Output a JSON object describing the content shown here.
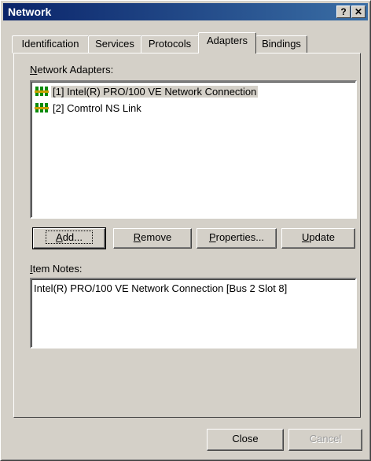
{
  "window": {
    "title": "Network",
    "help_label": "?",
    "close_label": "✕"
  },
  "tabs": [
    {
      "label": "Identification"
    },
    {
      "label": "Services"
    },
    {
      "label": "Protocols"
    },
    {
      "label": "Adapters"
    },
    {
      "label": "Bindings"
    }
  ],
  "active_tab": "Adapters",
  "adapters": {
    "label_prefix": "N",
    "label_rest": "etwork Adapters:",
    "items": [
      {
        "label": "[1] Intel(R) PRO/100 VE Network Connection",
        "icon": "network-card-icon",
        "selected": true
      },
      {
        "label": "[2] Comtrol NS Link",
        "icon": "network-card-icon",
        "selected": false
      }
    ]
  },
  "buttons": {
    "add": {
      "pre": "",
      "ul": "A",
      "post": "dd..."
    },
    "remove": {
      "pre": "",
      "ul": "R",
      "post": "emove"
    },
    "properties": {
      "pre": "",
      "ul": "P",
      "post": "roperties..."
    },
    "update": {
      "pre": "",
      "ul": "U",
      "post": "pdate"
    }
  },
  "item_notes": {
    "label_prefix": "I",
    "label_rest": "tem Notes:",
    "text": "Intel(R) PRO/100 VE Network Connection [Bus 2 Slot 8]"
  },
  "footer": {
    "close_label": "Close",
    "cancel_label": "Cancel"
  }
}
